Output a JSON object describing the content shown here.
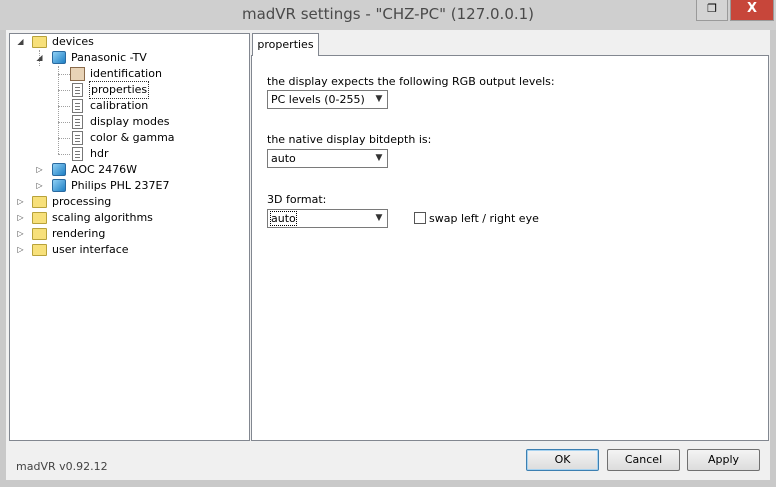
{
  "window": {
    "title": "madVR settings - \"CHZ-PC\" (127.0.0.1)",
    "restore_icon": "restore-icon",
    "close_label": "X"
  },
  "tree": {
    "items": [
      {
        "label": "devices",
        "icon": "folder-icon",
        "expanded": true
      },
      {
        "label": "Panasonic -TV",
        "icon": "monitor-icon",
        "expanded": true
      },
      {
        "label": "identification",
        "icon": "identification-icon"
      },
      {
        "label": "properties",
        "icon": "page-icon",
        "selected": true
      },
      {
        "label": "calibration",
        "icon": "page-icon"
      },
      {
        "label": "display modes",
        "icon": "page-icon"
      },
      {
        "label": "color & gamma",
        "icon": "page-icon"
      },
      {
        "label": "hdr",
        "icon": "page-icon"
      },
      {
        "label": "AOC 2476W",
        "icon": "monitor-icon",
        "expanded": false
      },
      {
        "label": "Philips PHL 237E7",
        "icon": "monitor-icon",
        "expanded": false
      },
      {
        "label": "processing",
        "icon": "folder-icon",
        "expanded": false
      },
      {
        "label": "scaling algorithms",
        "icon": "folder-icon",
        "expanded": false
      },
      {
        "label": "rendering",
        "icon": "folder-icon",
        "expanded": false
      },
      {
        "label": "user interface",
        "icon": "folder-icon",
        "expanded": false
      }
    ]
  },
  "panel": {
    "tab_label": "properties",
    "rgb_label": "the display expects the following RGB output levels:",
    "rgb_value": "PC levels (0-255)",
    "bitdepth_label": "the native display bitdepth is:",
    "bitdepth_value": "auto",
    "format3d_label": "3D format:",
    "format3d_value": "auto",
    "swap_label": "swap left / right eye",
    "swap_checked": false
  },
  "footer": {
    "version": "madVR v0.92.12",
    "ok_label": "OK",
    "cancel_label": "Cancel",
    "apply_label": "Apply"
  }
}
